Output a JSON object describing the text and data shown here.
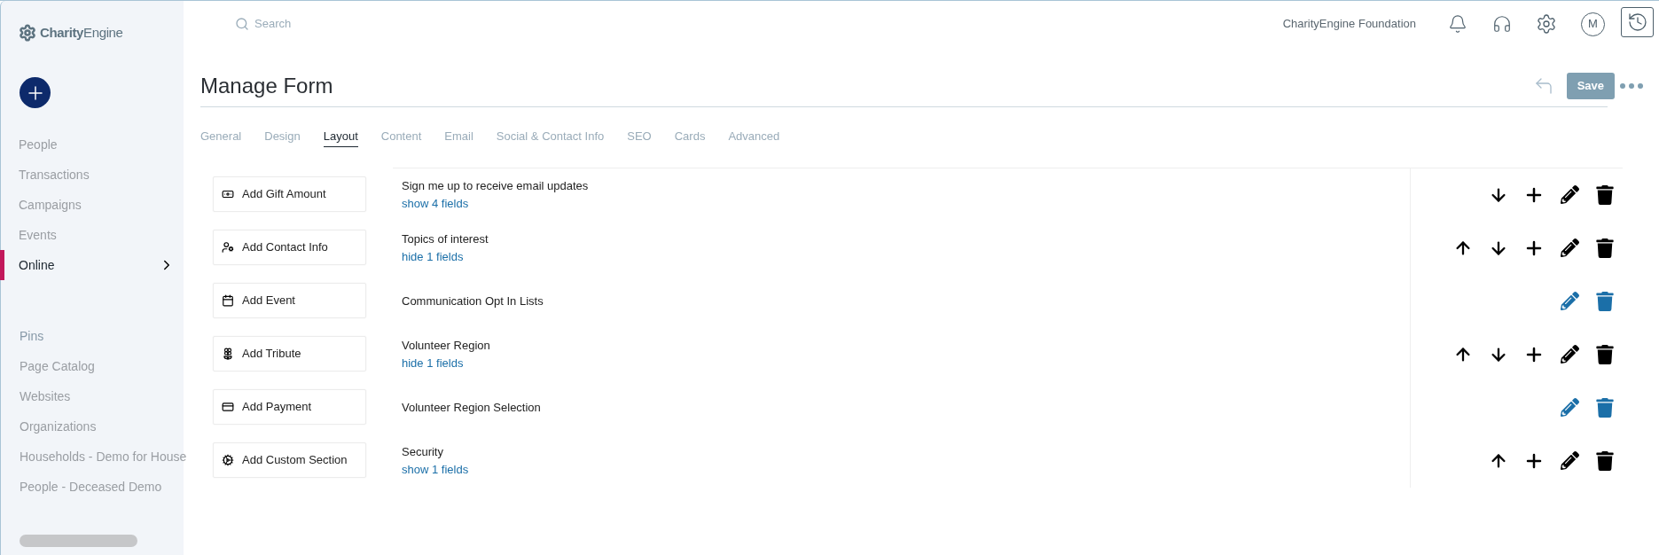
{
  "sidebar": {
    "logo": "**Charity**Engine",
    "items": [
      {
        "label": "People",
        "selected": false,
        "submenu": false
      },
      {
        "label": "Transactions",
        "selected": false,
        "submenu": false
      },
      {
        "label": "Campaigns",
        "selected": false,
        "submenu": false
      },
      {
        "label": "Events",
        "selected": false,
        "submenu": false
      },
      {
        "label": "Online",
        "selected": true,
        "submenu": true
      }
    ],
    "pins_label": "Pins",
    "pins": [
      "Page Catalog",
      "Websites",
      "Organizations",
      "Households - Demo for House",
      "People - Deceased Demo"
    ]
  },
  "topbar": {
    "search": {
      "placeholder": "Search"
    },
    "organization": "CharityEngine Foundation",
    "avatar": "M"
  },
  "page": {
    "title": "Manage Form",
    "save_label": "Save"
  },
  "tabs": [
    {
      "label": "General",
      "selected": false
    },
    {
      "label": "Design",
      "selected": false
    },
    {
      "label": "Layout",
      "selected": true
    },
    {
      "label": "Content",
      "selected": false
    },
    {
      "label": "Email",
      "selected": false
    },
    {
      "label": "Social & Contact Info",
      "selected": false
    },
    {
      "label": "SEO",
      "selected": false
    },
    {
      "label": "Cards",
      "selected": false
    },
    {
      "label": "Advanced",
      "selected": false
    }
  ],
  "add_buttons": [
    {
      "kind": "gift",
      "label": "Add Gift Amount"
    },
    {
      "kind": "contact",
      "label": "Add Contact Info"
    },
    {
      "kind": "event",
      "label": "Add Event"
    },
    {
      "kind": "tribute",
      "label": "Add Tribute"
    },
    {
      "kind": "payment",
      "label": "Add Payment"
    },
    {
      "kind": "custom",
      "label": "Add Custom Section"
    }
  ],
  "sections": [
    {
      "title": "Sign me up to receive email updates",
      "toggle": "show 4 fields",
      "highlighted": false,
      "actions": [
        {
          "kind": "down"
        },
        {
          "kind": "add"
        },
        {
          "kind": "edit"
        },
        {
          "kind": "delete"
        }
      ]
    },
    {
      "title": "Topics of interest",
      "toggle": "hide 1 fields",
      "highlighted": false,
      "actions": [
        {
          "kind": "up"
        },
        {
          "kind": "down"
        },
        {
          "kind": "add"
        },
        {
          "kind": "edit"
        },
        {
          "kind": "delete"
        }
      ]
    },
    {
      "title": "Communication Opt In Lists",
      "highlighted": true,
      "actions": [
        {
          "kind": "edit"
        },
        {
          "kind": "delete"
        }
      ]
    },
    {
      "title": "Volunteer Region",
      "toggle": "hide 1 fields",
      "highlighted": false,
      "actions": [
        {
          "kind": "up"
        },
        {
          "kind": "down"
        },
        {
          "kind": "add"
        },
        {
          "kind": "edit"
        },
        {
          "kind": "delete"
        }
      ]
    },
    {
      "title": "Volunteer Region Selection",
      "highlighted": true,
      "actions": [
        {
          "kind": "edit"
        },
        {
          "kind": "delete"
        }
      ]
    },
    {
      "title": "Security",
      "toggle": "show 1 fields",
      "highlighted": false,
      "actions": [
        {
          "kind": "up"
        },
        {
          "kind": "add"
        },
        {
          "kind": "edit"
        },
        {
          "kind": "delete"
        }
      ]
    }
  ]
}
